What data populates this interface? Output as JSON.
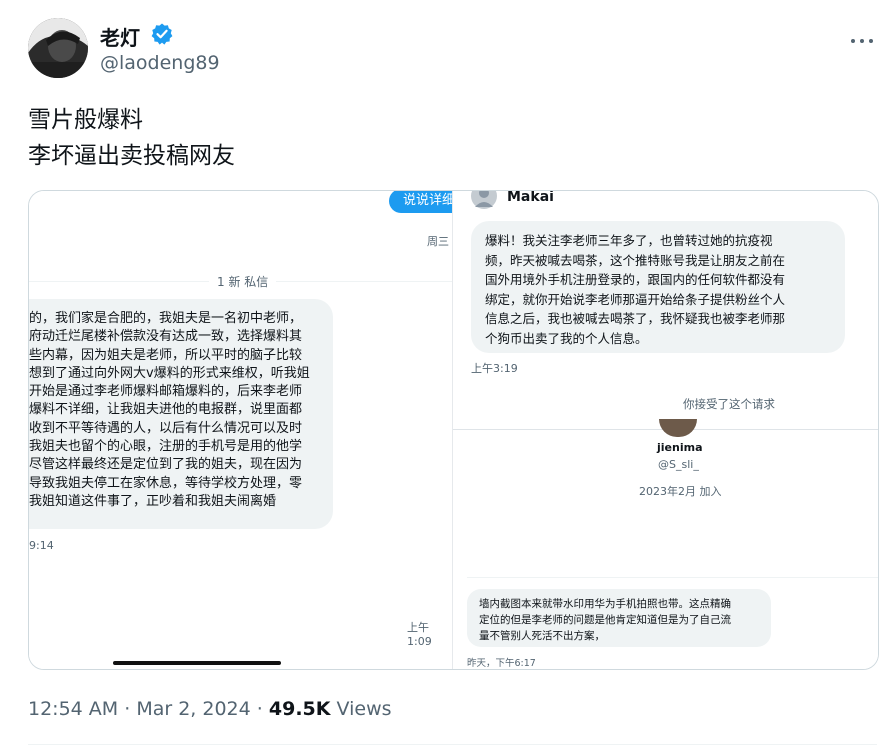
{
  "author": {
    "name": "老灯",
    "handle": "@laodeng89"
  },
  "tweet": {
    "line1": "雪片般爆料",
    "line2": "李坏逼出卖投稿网友"
  },
  "left_shot": {
    "sent_bubble": "说说详细",
    "sent_time": "周三",
    "new_message_divider": "1 新 私信",
    "message_lines": [
      "的，我们家是合肥的，我姐夫是一名初中老师，",
      "府动迁烂尾楼补偿款没有达成一致，选择爆料其",
      "些内幕，因为姐夫是老师，所以平时的脑子比较",
      "想到了通过向外网大v爆料的形式来维权，听我姐",
      "开始是通过李老师爆料邮箱爆料的，后来李老师",
      "爆料不详细，让我姐夫进他的电报群，说里面都",
      "收到不平等待遇的人，以后有什么情况可以及时",
      "我姐夫也留个的心眼，注册的手机号是用的他学",
      "尽管这样最终还是定位到了我的姐夫，现在因为",
      "导致我姐夫停工在家休息，等待学校方处理，零",
      "我姐知道这件事了，正吵着和我姐夫闹离婚"
    ],
    "msg_time": "9:14",
    "bottom_time": "上午1:09"
  },
  "right_shot": {
    "sender": "Makai",
    "message_lines": [
      "爆料！我关注李老师三年多了，也曾转过她的抗疫视",
      "频，昨天被喊去喝茶，这个推特账号我是让朋友之前在",
      "国外用境外手机注册登录的，跟国内的任何软件都没有",
      "绑定，就你开始说李老师那逼开始给条子提供粉丝个人",
      "信息之后，我也被喊去喝茶了，我怀疑我也被李老师那",
      "个狗币出卖了我的个人信息。"
    ],
    "msg_time": "上午3:19",
    "accepted": "你接受了这个请求",
    "profile_name": "jienima",
    "profile_handle": "@S_sli_",
    "joined": "2023年2月 加入",
    "message2_lines": [
      "墙内截图本来就带水印用华为手机拍照也带。这点精确",
      "定位的但是李老师的问题是他肯定知道但是为了自己流",
      "量不管别人死活不出方案，"
    ],
    "msg2_time": "昨天，下午6:17"
  },
  "meta": {
    "time": "12:54 AM",
    "date": "Mar 2, 2024",
    "views_count": "49.5K",
    "views_label": "Views"
  },
  "icons": {
    "verified": "verified-badge-icon",
    "more": "more-horizontal-icon"
  },
  "colors": {
    "accent": "#1d9bf0",
    "text": "#0f1419",
    "muted": "#536471",
    "bubble": "#eff3f4"
  }
}
